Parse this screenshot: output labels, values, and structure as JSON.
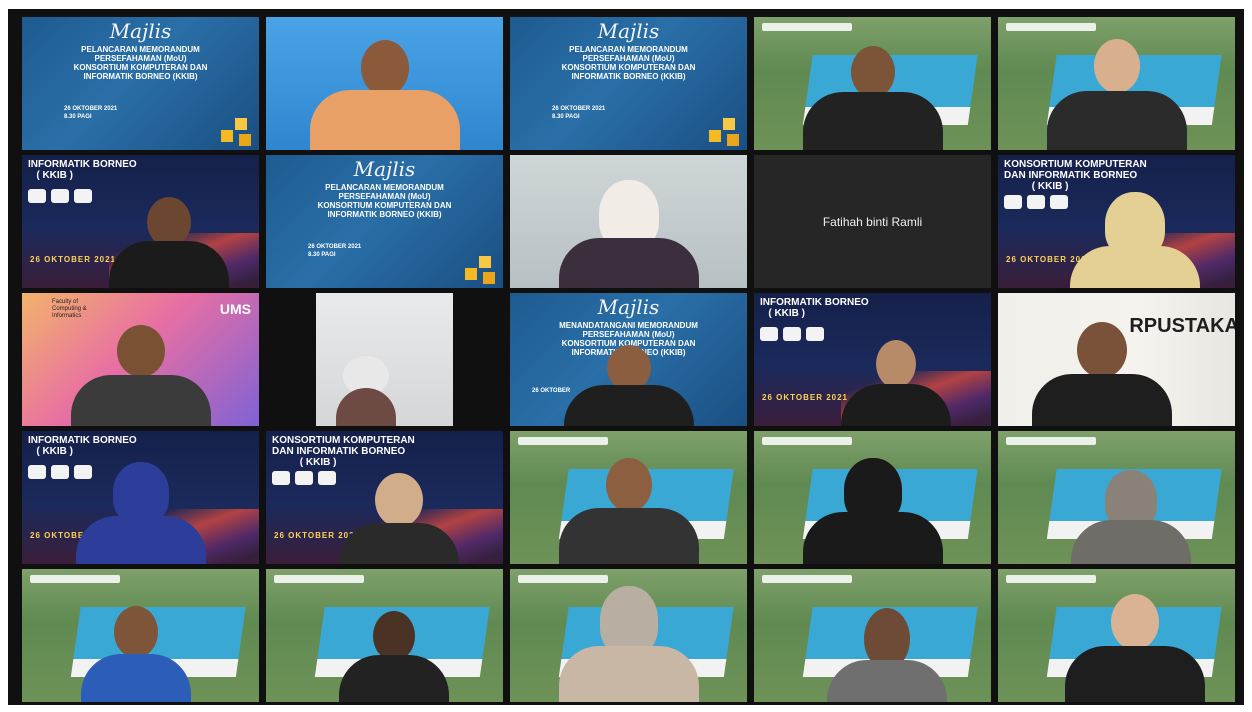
{
  "meeting": {
    "slide_majlis": {
      "script_title": "Majlis",
      "text": "PELANCARAN MEMORANDUM\nPERSEFAHAMAN (MoU)\nKONSORTIUM KOMPUTERAN DAN\nINFORMATIK BORNEO (KKIB)",
      "date": "26 OKTOBER 2021\n8.30 PAGI"
    },
    "slide_signing": {
      "script_title": "Majlis",
      "text": "MENANDATANGANI MEMORANDUM\nPERSEFAHAMAN (MoU)\nKONSORTIUM KOMPUTERAN DAN\nINFORMATIK BORNEO (KKIB)",
      "date": "26 OKTOBER"
    },
    "kkib_bg_a": {
      "title": "INFORMATIK BORNEO\n   ( KKIB )",
      "date": "26 OKTOBER 2021"
    },
    "kkib_bg_b": {
      "title": "KONSORTIUM KOMPUTERAN\nDAN INFORMATIK BORNEO\n          ( KKIB )",
      "date": "26 OKTOBER 2021"
    },
    "ums_bg": {
      "logo": "UMS",
      "faculty": "Faculty of\nComputing &\nInformatics"
    },
    "perpus_bg": {
      "text": "RPUSTAKA"
    },
    "name_only_tile": {
      "name": "Fatihah binti Ramli"
    }
  },
  "colors": {
    "frame": "#101010",
    "campus_roof": "#3aa8d4",
    "kkib_navy": "#15204a",
    "slide_blue": "#2a6fa8"
  }
}
